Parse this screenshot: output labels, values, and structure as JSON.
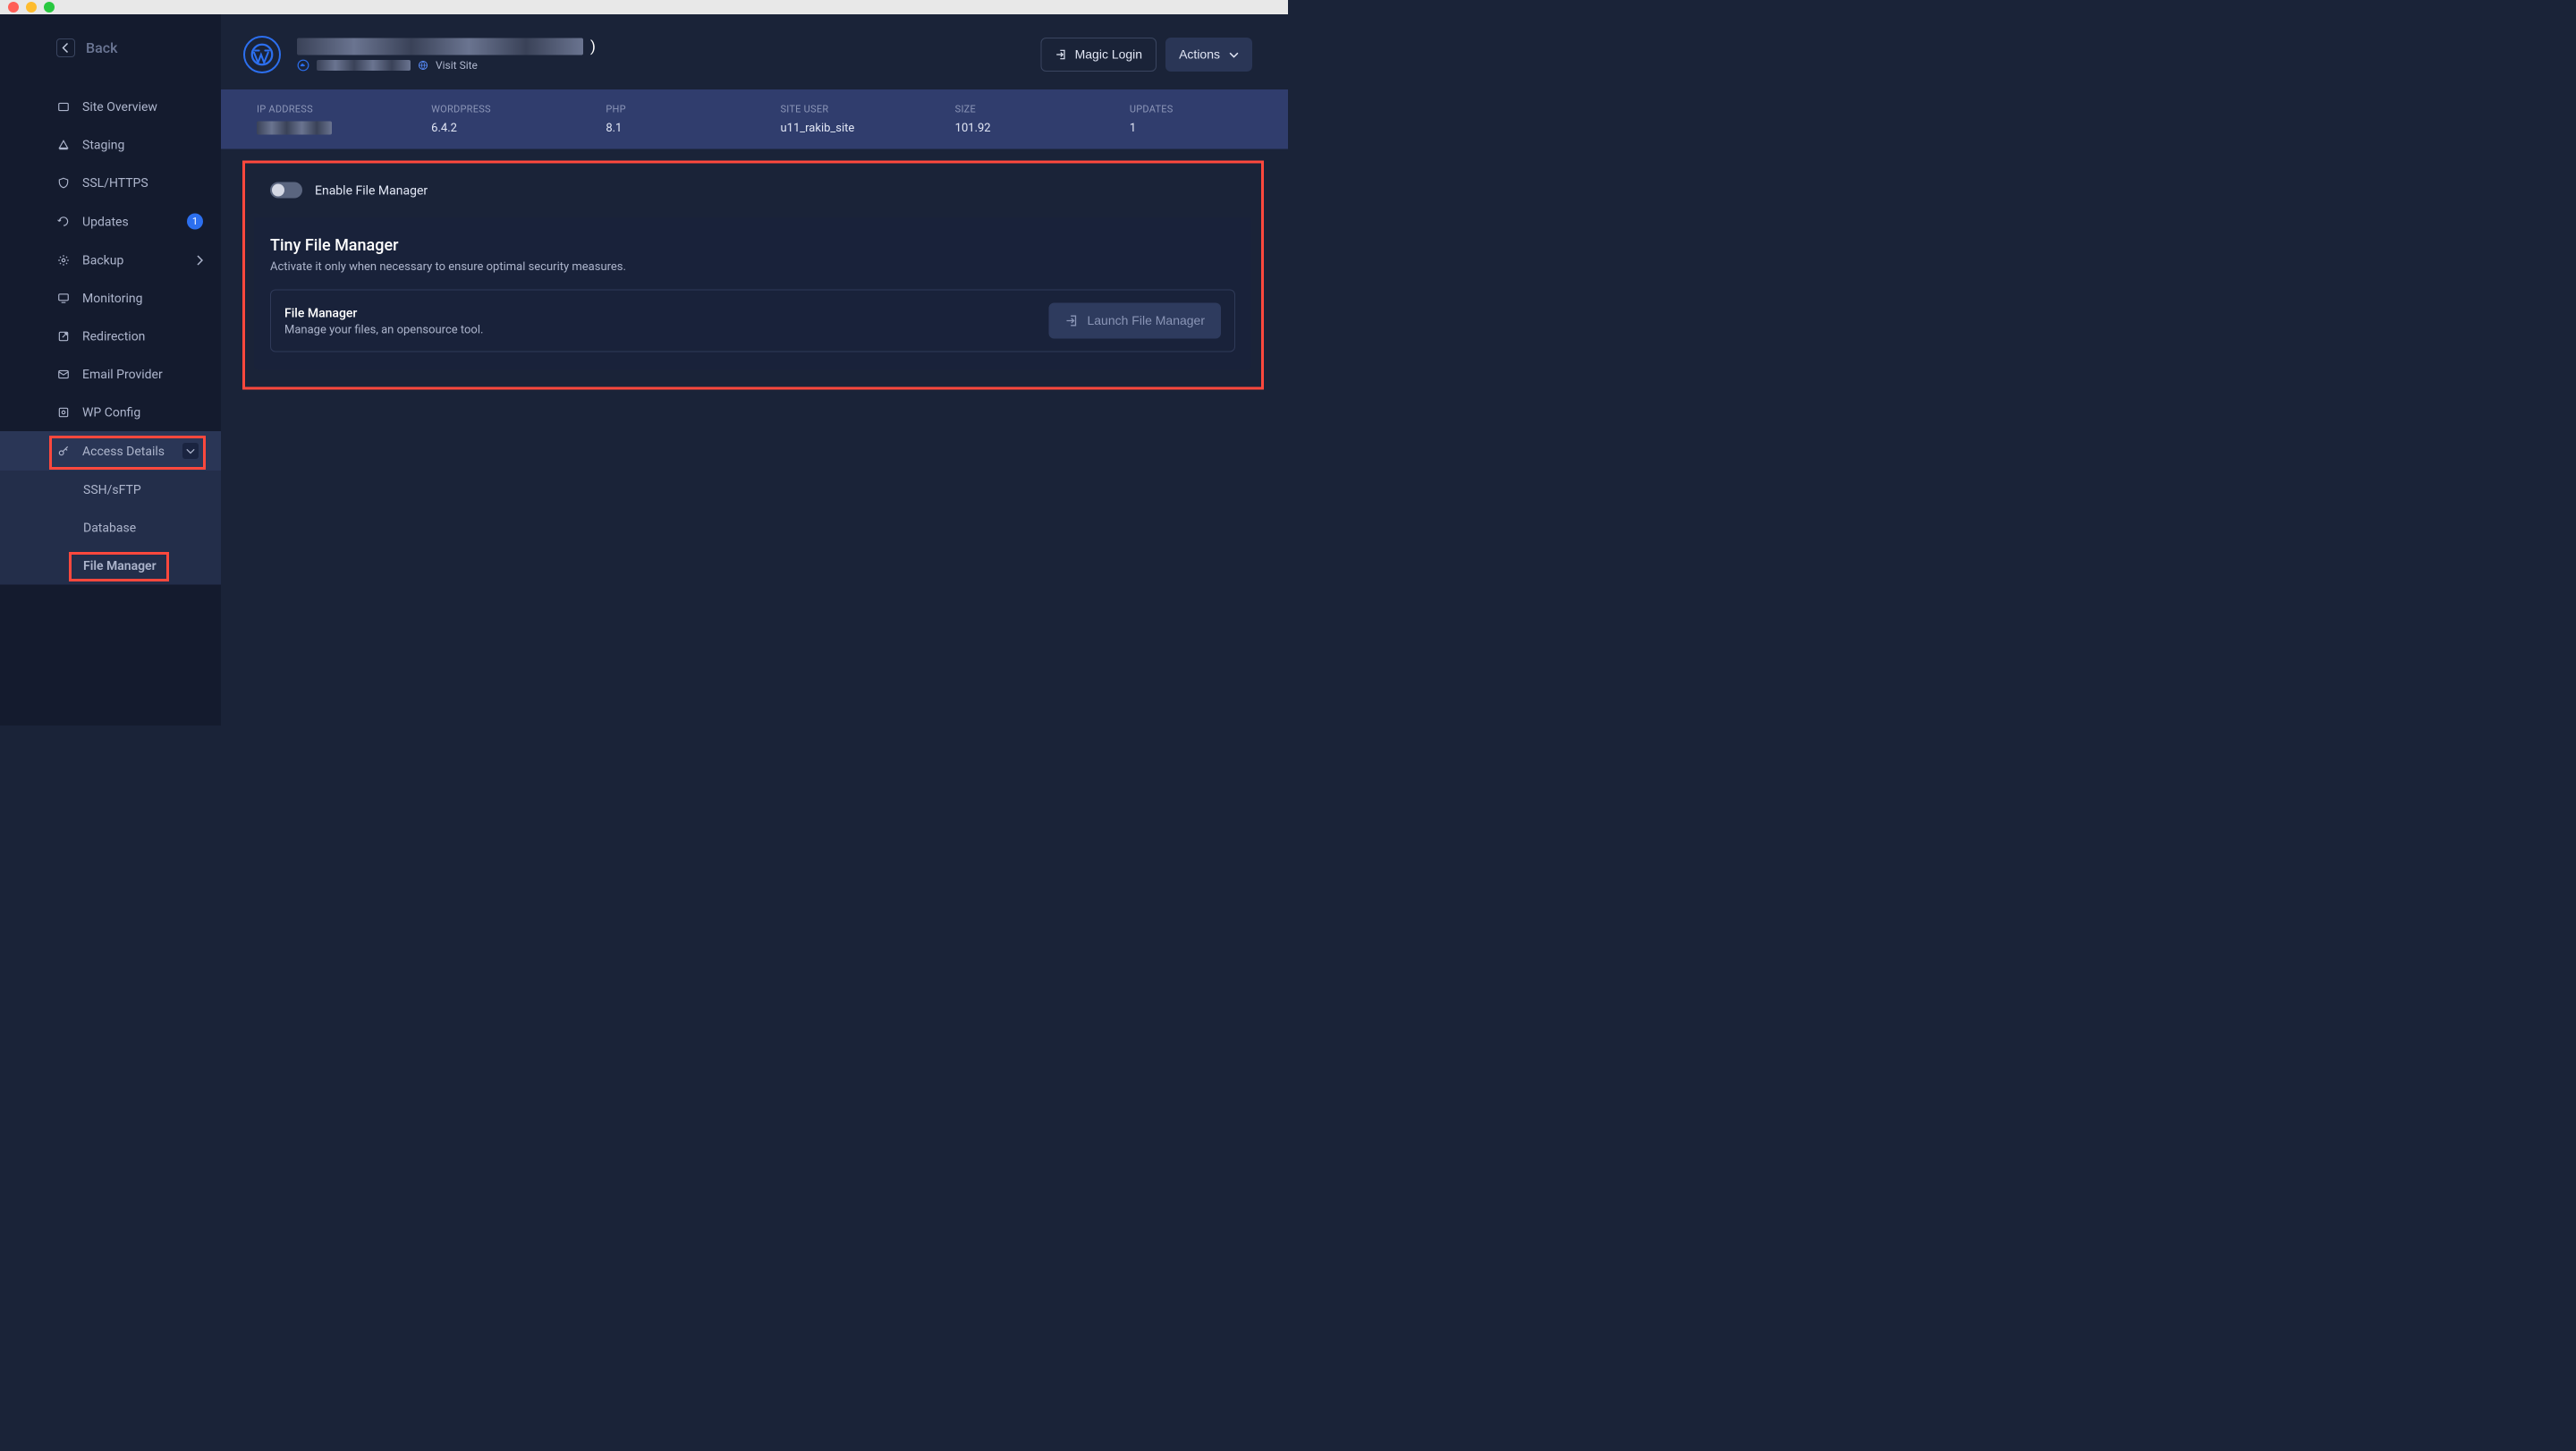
{
  "back_label": "Back",
  "sidebar": {
    "items": [
      {
        "label": "Site Overview"
      },
      {
        "label": "Staging"
      },
      {
        "label": "SSL/HTTPS"
      },
      {
        "label": "Updates",
        "badge": "1"
      },
      {
        "label": "Backup"
      },
      {
        "label": "Monitoring"
      },
      {
        "label": "Redirection"
      },
      {
        "label": "Email Provider"
      },
      {
        "label": "WP Config"
      },
      {
        "label": "Access Details"
      },
      {
        "label": "SSH/sFTP"
      },
      {
        "label": "Database"
      },
      {
        "label": "File Manager"
      }
    ]
  },
  "header": {
    "visit_site": "Visit Site",
    "magic_login": "Magic Login",
    "actions": "Actions"
  },
  "stats": {
    "ip_label": "IP ADDRESS",
    "ip_value": "",
    "wp_label": "WORDPRESS",
    "wp_value": "6.4.2",
    "php_label": "PHP",
    "php_value": "8.1",
    "user_label": "SITE USER",
    "user_value": "u11_rakib_site",
    "size_label": "SIZE",
    "size_value": "101.92",
    "updates_label": "UPDATES",
    "updates_value": "1"
  },
  "panel": {
    "enable_label": "Enable File Manager",
    "title": "Tiny File Manager",
    "desc": "Activate it only when necessary to ensure optimal security measures.",
    "fm_label": "File Manager",
    "fm_sub": "Manage your files, an opensource tool.",
    "launch": "Launch File Manager"
  }
}
